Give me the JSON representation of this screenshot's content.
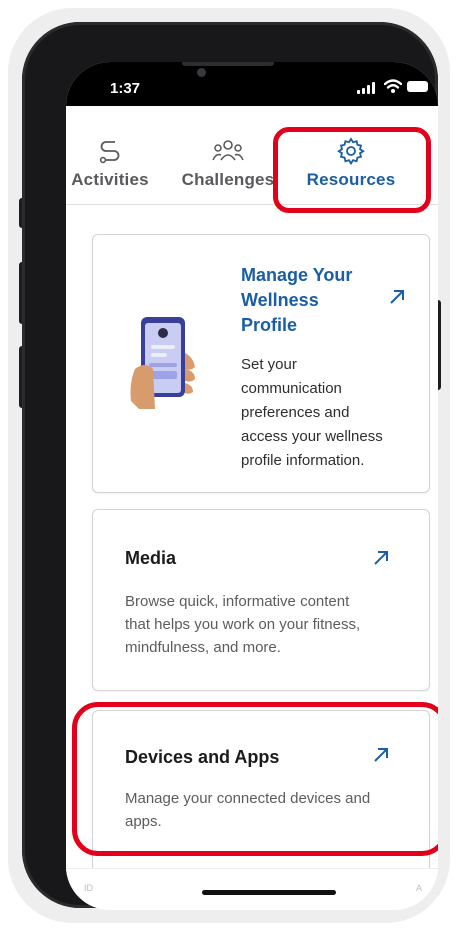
{
  "status_bar": {
    "time": "1:37"
  },
  "tabs": [
    {
      "label": "Activities",
      "icon": "route-icon"
    },
    {
      "label": "Challenges",
      "icon": "group-icon"
    },
    {
      "label": "Resources",
      "icon": "gear-icon",
      "active": true
    }
  ],
  "cards": {
    "wellness": {
      "title_lines": [
        "Manage Your",
        "Wellness",
        "Profile"
      ],
      "description_lines": [
        "Set your",
        "communication",
        "preferences and",
        "access your wellness",
        "profile information."
      ],
      "illustration": "hand-holding-phone-illustration"
    },
    "media": {
      "title": "Media",
      "description_lines": [
        "Browse quick, informative content",
        "that helps you work on your fitness,",
        "mindfulness, and more."
      ]
    },
    "devices": {
      "title": "Devices and Apps",
      "description_lines": [
        "Manage your connected devices and",
        "apps."
      ]
    }
  },
  "bottom_hint": {
    "left": "ID",
    "right": "A"
  },
  "colors": {
    "accent": "#1a5ea6",
    "highlight": "#e2001a",
    "text_dark": "#1b1b1d",
    "text_muted": "#5c5c60"
  }
}
